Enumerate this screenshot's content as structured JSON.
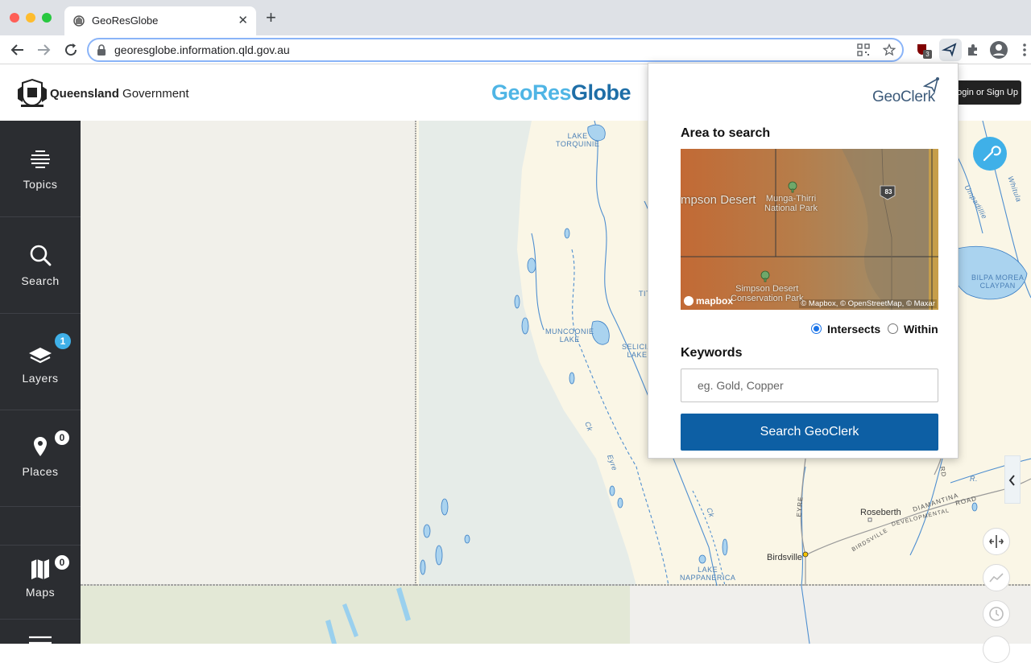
{
  "browser": {
    "tab_title": "GeoResGlobe",
    "tab_close_glyph": "✕",
    "new_tab_glyph": "+",
    "url": "georesglobe.information.qld.gov.au",
    "extension_badge": "3"
  },
  "header": {
    "qld_bold": "Queensland",
    "qld_rest": " Government",
    "title_geo": "GeoRes",
    "title_globe": "Globe",
    "login_label": "Login or Sign Up"
  },
  "sidebar": {
    "items": [
      {
        "label": "Topics",
        "icon": "topics-icon"
      },
      {
        "label": "Search",
        "icon": "search-icon"
      },
      {
        "label": "Layers",
        "icon": "layers-icon",
        "badge": "1"
      },
      {
        "label": "Places",
        "icon": "map-pin-icon",
        "badge": "0"
      },
      {
        "label": "Maps",
        "icon": "map-icon",
        "badge": "0"
      }
    ]
  },
  "map": {
    "labels": {
      "lake_torquinie": "LAKE\nTORQUINIE",
      "muncoonie": "MUNCOONIE\nLAKE",
      "selicia": "SELICIA\nLAKE",
      "bilpa": "BILPA MOREA\nCLAYPAN",
      "nappanerica": "LAKE\nNAPPANERICA",
      "tit": "TIT",
      "umpadillie": "Umpadillie",
      "whitula": "Whitula",
      "eyre": "EYRE",
      "rd": "RD",
      "diamantina": "DIAMANTINA",
      "developmental": "DEVELOPMENTAL",
      "road": "ROAD",
      "birdsville_rd": "BIRDSVILLE",
      "r": "R.",
      "creek1": "Ck",
      "eyre_ck": "Eyre",
      "ck2": "Ck"
    },
    "towns": {
      "rosebeth": "Roseberth",
      "birdsville": "Birdsville"
    }
  },
  "popup": {
    "brand": "GeoClerk",
    "area_heading": "Area to search",
    "area_map": {
      "label_desert": "mpson Desert",
      "label_park1": "Munga-Thirri\nNational Park",
      "label_park2": "Simpson Desert\nConservation Park",
      "route": "83",
      "mapbox": "mapbox",
      "attribution": "© Mapbox, © OpenStreetMap, © Maxar"
    },
    "radio_intersects": "Intersects",
    "radio_within": "Within",
    "keywords_heading": "Keywords",
    "keywords_placeholder": "eg. Gold, Copper",
    "search_button": "Search GeoClerk"
  }
}
